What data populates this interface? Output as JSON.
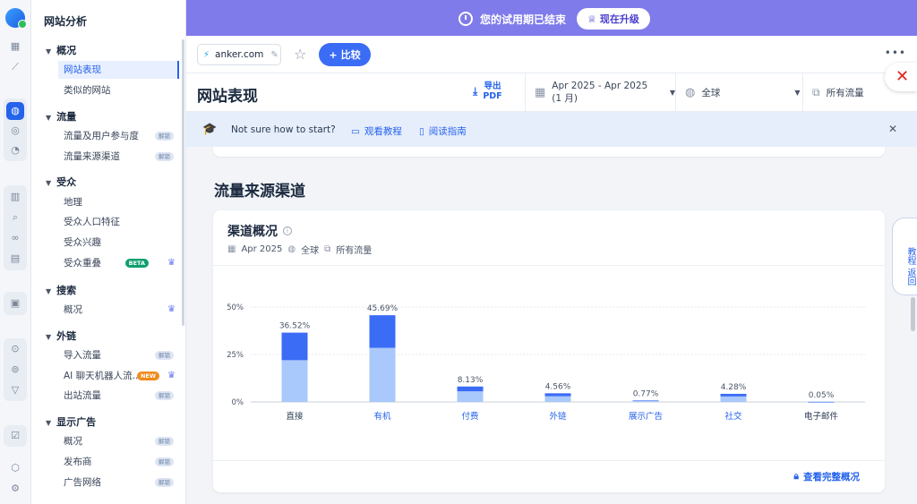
{
  "colors": {
    "accent": "#2563eb",
    "banner": "#7f7bea",
    "bar_dark": "#3b6cf5",
    "bar_light": "#a9c8fb"
  },
  "nav": {
    "title": "网站分析",
    "sections": [
      {
        "label": "概况",
        "items": [
          {
            "label": "网站表现",
            "selected": true
          },
          {
            "label": "类似的网站"
          }
        ]
      },
      {
        "label": "流量",
        "items": [
          {
            "label": "流量及用户参与度",
            "badge": "解锁"
          },
          {
            "label": "流量来源渠道",
            "badge": "解锁"
          }
        ]
      },
      {
        "label": "受众",
        "items": [
          {
            "label": "地理"
          },
          {
            "label": "受众人口特征"
          },
          {
            "label": "受众兴趣"
          },
          {
            "label": "受众重叠",
            "badge": "BETA",
            "crown": true
          }
        ]
      },
      {
        "label": "搜索",
        "items": [
          {
            "label": "概况",
            "crown": true
          }
        ]
      },
      {
        "label": "外链",
        "items": [
          {
            "label": "导入流量",
            "badge": "解锁"
          },
          {
            "label": "AI 聊天机器人流...",
            "badge": "NEW",
            "crown": true
          },
          {
            "label": "出站流量",
            "badge": "解锁"
          }
        ]
      },
      {
        "label": "显示广告",
        "items": [
          {
            "label": "概况",
            "badge": "解锁"
          },
          {
            "label": "发布商",
            "badge": "解锁"
          },
          {
            "label": "广告网络",
            "badge": "解锁"
          }
        ]
      }
    ]
  },
  "banner": {
    "text": "您的试用期已结束",
    "upgrade_label": "现在升级"
  },
  "domainbar": {
    "domain": "anker.com",
    "compare_label": "比较"
  },
  "header": {
    "title": "网站表现",
    "export_line1": "导出",
    "export_line2": "PDF",
    "date_range": "Apr 2025 - Apr 2025 (1 月)",
    "region": "全球",
    "traffic": "所有流量"
  },
  "hint": {
    "text": "Not sure how to start?",
    "tutorial": "观看教程",
    "guide": "阅读指南"
  },
  "section_heading": "流量来源渠道",
  "card": {
    "title": "渠道概况",
    "meta_date": "Apr 2025",
    "meta_region": "全球",
    "meta_traffic": "所有流量",
    "full_link": "查看完整概况"
  },
  "side_tab": "教程 返回",
  "chart_data": {
    "type": "bar",
    "categories": [
      "直接",
      "有机",
      "付费",
      "外链",
      "展示广告",
      "社交",
      "电子邮件"
    ],
    "values": [
      36.52,
      45.69,
      8.13,
      4.56,
      0.77,
      4.28,
      0.05
    ],
    "value_labels": [
      "36.52%",
      "45.69%",
      "8.13%",
      "4.56%",
      "0.77%",
      "4.28%",
      "0.05%"
    ],
    "series": [
      {
        "values": [
          22.0,
          28.5,
          5.6,
          3.0,
          0.6,
          2.9,
          0.04
        ]
      },
      {
        "values": [
          14.52,
          17.19,
          2.53,
          1.56,
          0.17,
          1.38,
          0.01
        ]
      }
    ],
    "ylim": [
      0,
      50
    ],
    "yticks": [
      "0%",
      "25%",
      "50%"
    ],
    "ytick_values": [
      0,
      25,
      50
    ],
    "grid": true
  }
}
